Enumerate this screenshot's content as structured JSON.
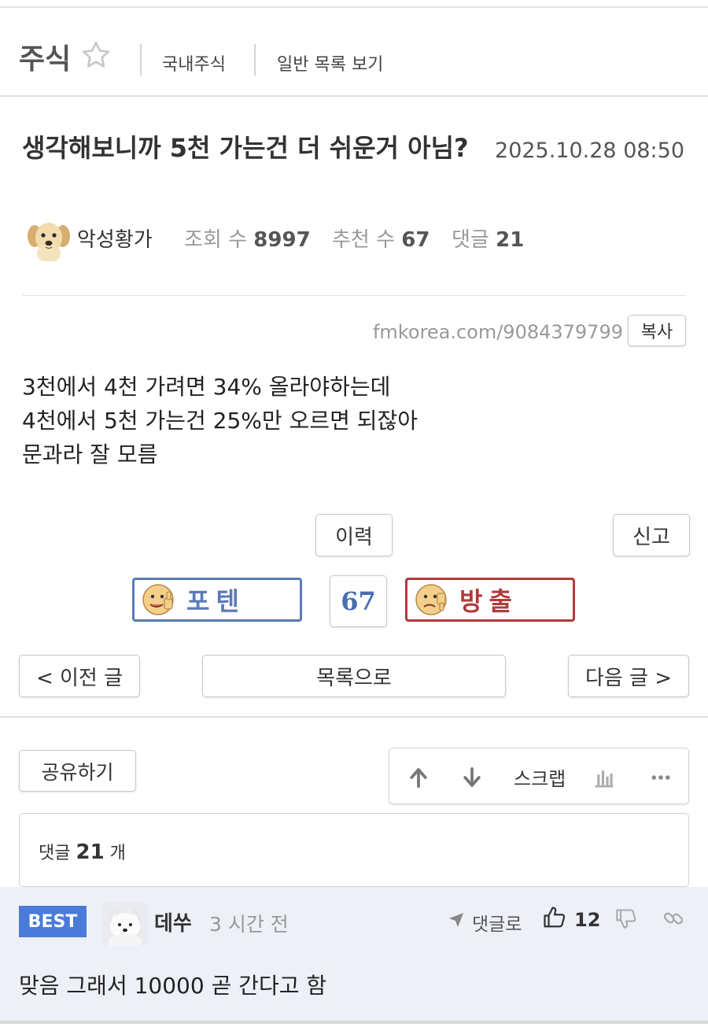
{
  "board": {
    "title": "주식",
    "links": [
      "국내주식",
      "일반 목록 보기"
    ]
  },
  "post": {
    "title": "생각해보니까 5천 가는건 더 쉬운거 아님?",
    "date": "2025.10.28 08:50",
    "author": "악성황가",
    "views_label": "조회 수",
    "views": "8997",
    "recommend_label": "추천 수",
    "recommend": "67",
    "comments_label": "댓글",
    "comments": "21",
    "url": "fmkorea.com/9084379799",
    "copy_label": "복사",
    "body": [
      "3천에서 4천 가려면 34% 올라야하는데",
      "4천에서 5천 가는건 25%만 오르면 되잖아",
      "문과라 잘 모름"
    ],
    "history_label": "이력",
    "report_label": "신고"
  },
  "vote": {
    "up_label": "포텐",
    "count": "67",
    "down_label": "방출",
    "up_color": "#5a7ab8",
    "down_color": "#b23a3a"
  },
  "nav": {
    "prev": "< 이전 글",
    "list": "목록으로",
    "next": "다음 글 >"
  },
  "actions": {
    "share": "공유하기",
    "scrap": "스크랩"
  },
  "comments_summary": {
    "prefix": "댓글",
    "count": "21",
    "suffix": "개"
  },
  "best_comment": {
    "badge": "BEST",
    "author": "데쑤",
    "time": "3 시간 전",
    "reply_label": "댓글로",
    "likes": "12",
    "text": "맞음 그래서 10000 곧 간다고 함",
    "badge_color": "#4a7bd8"
  }
}
